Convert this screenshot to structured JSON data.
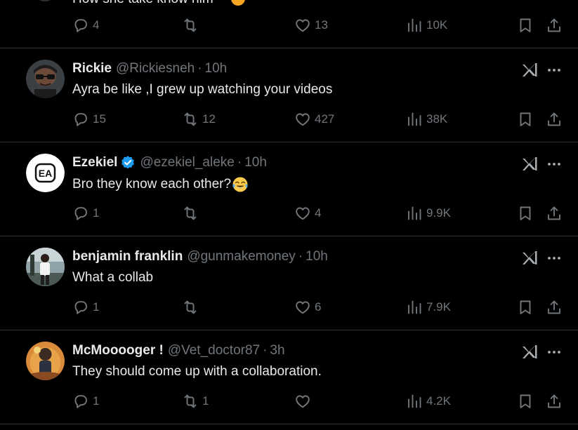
{
  "colors": {
    "background": "#000000",
    "text_primary": "#e7e9ea",
    "text_secondary": "#71767b",
    "divider": "#2f3336",
    "verified_badge": "#1d9bf0"
  },
  "top_partial": {
    "text": "How she take know him",
    "actions": {
      "replies": "4",
      "reposts": "",
      "likes": "13",
      "views": "10K"
    }
  },
  "tweets": [
    {
      "name": "Rickie",
      "handle": "@Rickiesneh",
      "separator": "·",
      "time": "10h",
      "verified": false,
      "text": "Ayra be like ,I grew up watching your videos",
      "emoji": "",
      "avatar": "cartoon-character-avatar",
      "actions": {
        "replies": "15",
        "reposts": "12",
        "likes": "427",
        "views": "38K"
      }
    },
    {
      "name": "Ezekiel",
      "handle": "@ezekiel_aleke",
      "separator": "·",
      "time": "10h",
      "verified": true,
      "text": "Bro they know each other?",
      "emoji": "face-with-tears-of-joy",
      "avatar_text": "EA",
      "actions": {
        "replies": "1",
        "reposts": "",
        "likes": "4",
        "views": "9.9K"
      }
    },
    {
      "name": "benjamin franklin",
      "handle": "@gunmakemoney",
      "separator": "·",
      "time": "10h",
      "verified": false,
      "text": "What a collab",
      "emoji": "",
      "avatar": "person-photo-avatar",
      "actions": {
        "replies": "1",
        "reposts": "",
        "likes": "6",
        "views": "7.9K"
      }
    },
    {
      "name": "McMooooger !",
      "handle": "@Vet_doctor87",
      "separator": "·",
      "time": "3h",
      "verified": false,
      "text": "They should come up with a collaboration.",
      "emoji": "",
      "avatar": "illustration-avatar",
      "actions": {
        "replies": "1",
        "reposts": "1",
        "likes": "",
        "views": "4.2K"
      }
    }
  ]
}
